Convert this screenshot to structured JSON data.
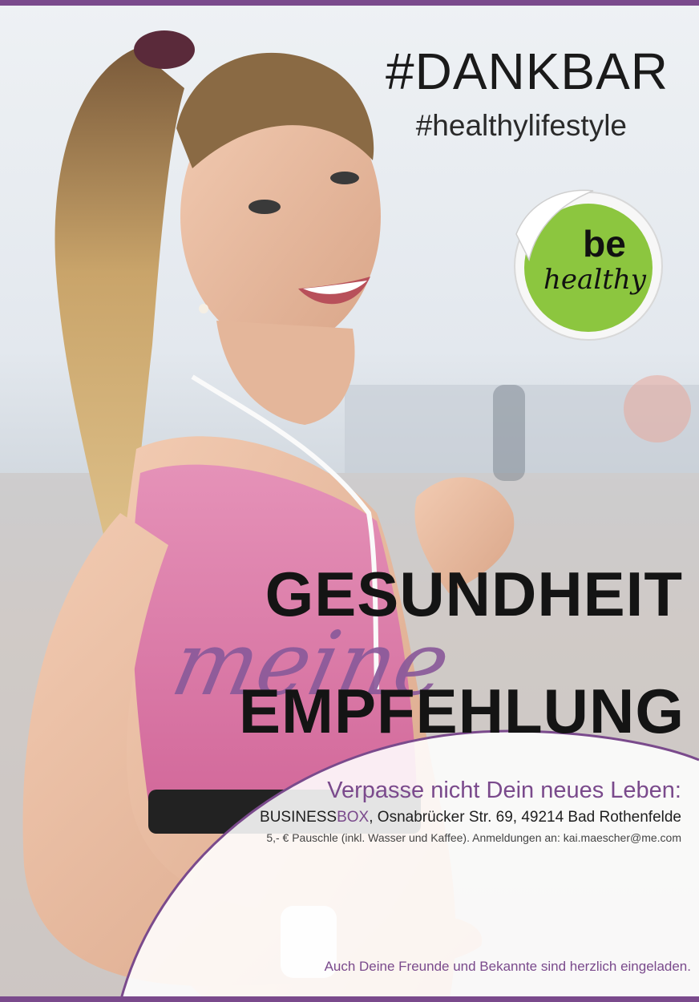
{
  "header": {
    "title": "#DANKBAR",
    "hashtag": "#healthylifestyle"
  },
  "sticker": {
    "line1": "be",
    "line2": "healthy"
  },
  "headline": {
    "line1": "GESUNDHEIT",
    "script": "meine",
    "line2": "EMPFEHLUNG"
  },
  "info": {
    "tagline": "Verpasse nicht Dein neues Leben:",
    "venue_part1": "BUSINESS",
    "venue_part2": "BOX",
    "address": ", Osnabrücker Str. 69, 49214 Bad Rothenfelde",
    "price_note": "5,- € Pauschle (inkl. Wasser und Kaffee). Anmeldungen an: kai.maescher@me.com"
  },
  "footer": {
    "note": "Auch Deine Freunde und Bekannte sind herzlich eingeladen."
  },
  "colors": {
    "accent": "#7a4a8c",
    "sticker_green": "#8cc63f",
    "text_dark": "#141414"
  }
}
